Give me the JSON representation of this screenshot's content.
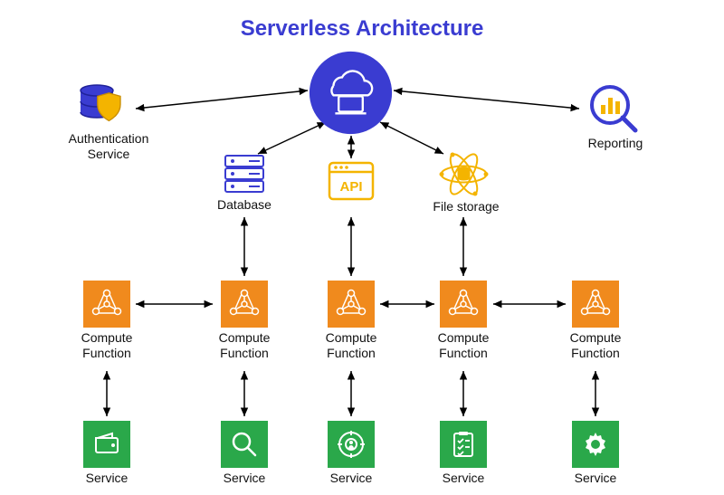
{
  "title": "Serverless Architecture",
  "colors": {
    "title": "#3a3cd1",
    "cloud_bg": "#3a3cd1",
    "compute_bg": "#f08a1d",
    "service_bg": "#2aa84a",
    "api_accent": "#f4b400",
    "db_accent": "#3a3cd1"
  },
  "nodes": {
    "cloud": {
      "label": ""
    },
    "authentication": {
      "label": "Authentication\nService"
    },
    "reporting": {
      "label": "Reporting"
    },
    "database": {
      "label": "Database"
    },
    "api": {
      "label": ""
    },
    "file_storage": {
      "label": "File storage"
    },
    "compute": [
      {
        "label": "Compute\nFunction"
      },
      {
        "label": "Compute\nFunction"
      },
      {
        "label": "Compute\nFunction"
      },
      {
        "label": "Compute\nFunction"
      },
      {
        "label": "Compute\nFunction"
      }
    ],
    "services": [
      {
        "label": "Service",
        "icon": "wallet"
      },
      {
        "label": "Service",
        "icon": "search"
      },
      {
        "label": "Service",
        "icon": "target"
      },
      {
        "label": "Service",
        "icon": "checklist"
      },
      {
        "label": "Service",
        "icon": "gear"
      }
    ]
  },
  "edges_description": "Cloud↔Authentication, Cloud↔Reporting, Cloud↔Database, Cloud↔API, Cloud↔FileStorage; Database↔Compute[1], API↔Compute[2], FileStorage↔Compute[3]; Compute[0]↔Compute[1], Compute[2]↔Compute[3], Compute[3]↔Compute[4]; Compute[i]↔Service[i] for i=0..4"
}
